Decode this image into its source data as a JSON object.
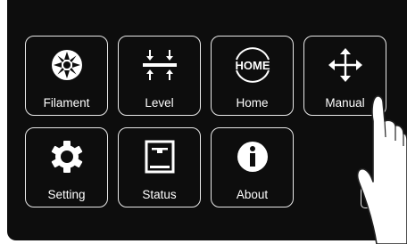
{
  "menu": {
    "items": [
      {
        "label": "Filament",
        "icon": "filament-icon"
      },
      {
        "label": "Level",
        "icon": "level-icon"
      },
      {
        "label": "Home",
        "icon": "home-icon"
      },
      {
        "label": "Manual",
        "icon": "move-arrows-icon"
      },
      {
        "label": "Setting",
        "icon": "gear-icon"
      },
      {
        "label": "Status",
        "icon": "printer-icon"
      },
      {
        "label": "About",
        "icon": "info-icon"
      }
    ],
    "home_icon_text": "HOME",
    "back_icon": "chevron-left-icon"
  },
  "colors": {
    "background": "#0d0d0d",
    "tile_border": "#e8e8e8",
    "text": "#ffffff"
  }
}
